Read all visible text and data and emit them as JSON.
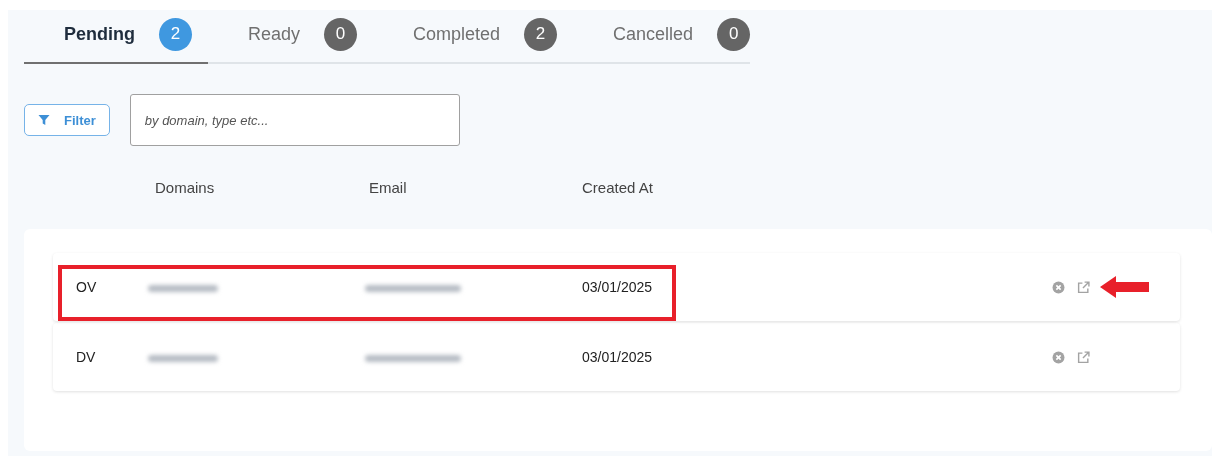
{
  "tabs": [
    {
      "label": "Pending",
      "count": "2",
      "selected": true
    },
    {
      "label": "Ready",
      "count": "0",
      "selected": false
    },
    {
      "label": "Completed",
      "count": "2",
      "selected": false
    },
    {
      "label": "Cancelled",
      "count": "0",
      "selected": false
    }
  ],
  "filter_button": {
    "label": "Filter"
  },
  "search": {
    "placeholder": "by domain, type etc..."
  },
  "table": {
    "columns": [
      "Domains",
      "Email",
      "Created At"
    ],
    "rows": [
      {
        "type": "OV",
        "created_at": "03/01/2025",
        "annotated": true
      },
      {
        "type": "DV",
        "created_at": "03/01/2025",
        "annotated": false
      }
    ]
  }
}
